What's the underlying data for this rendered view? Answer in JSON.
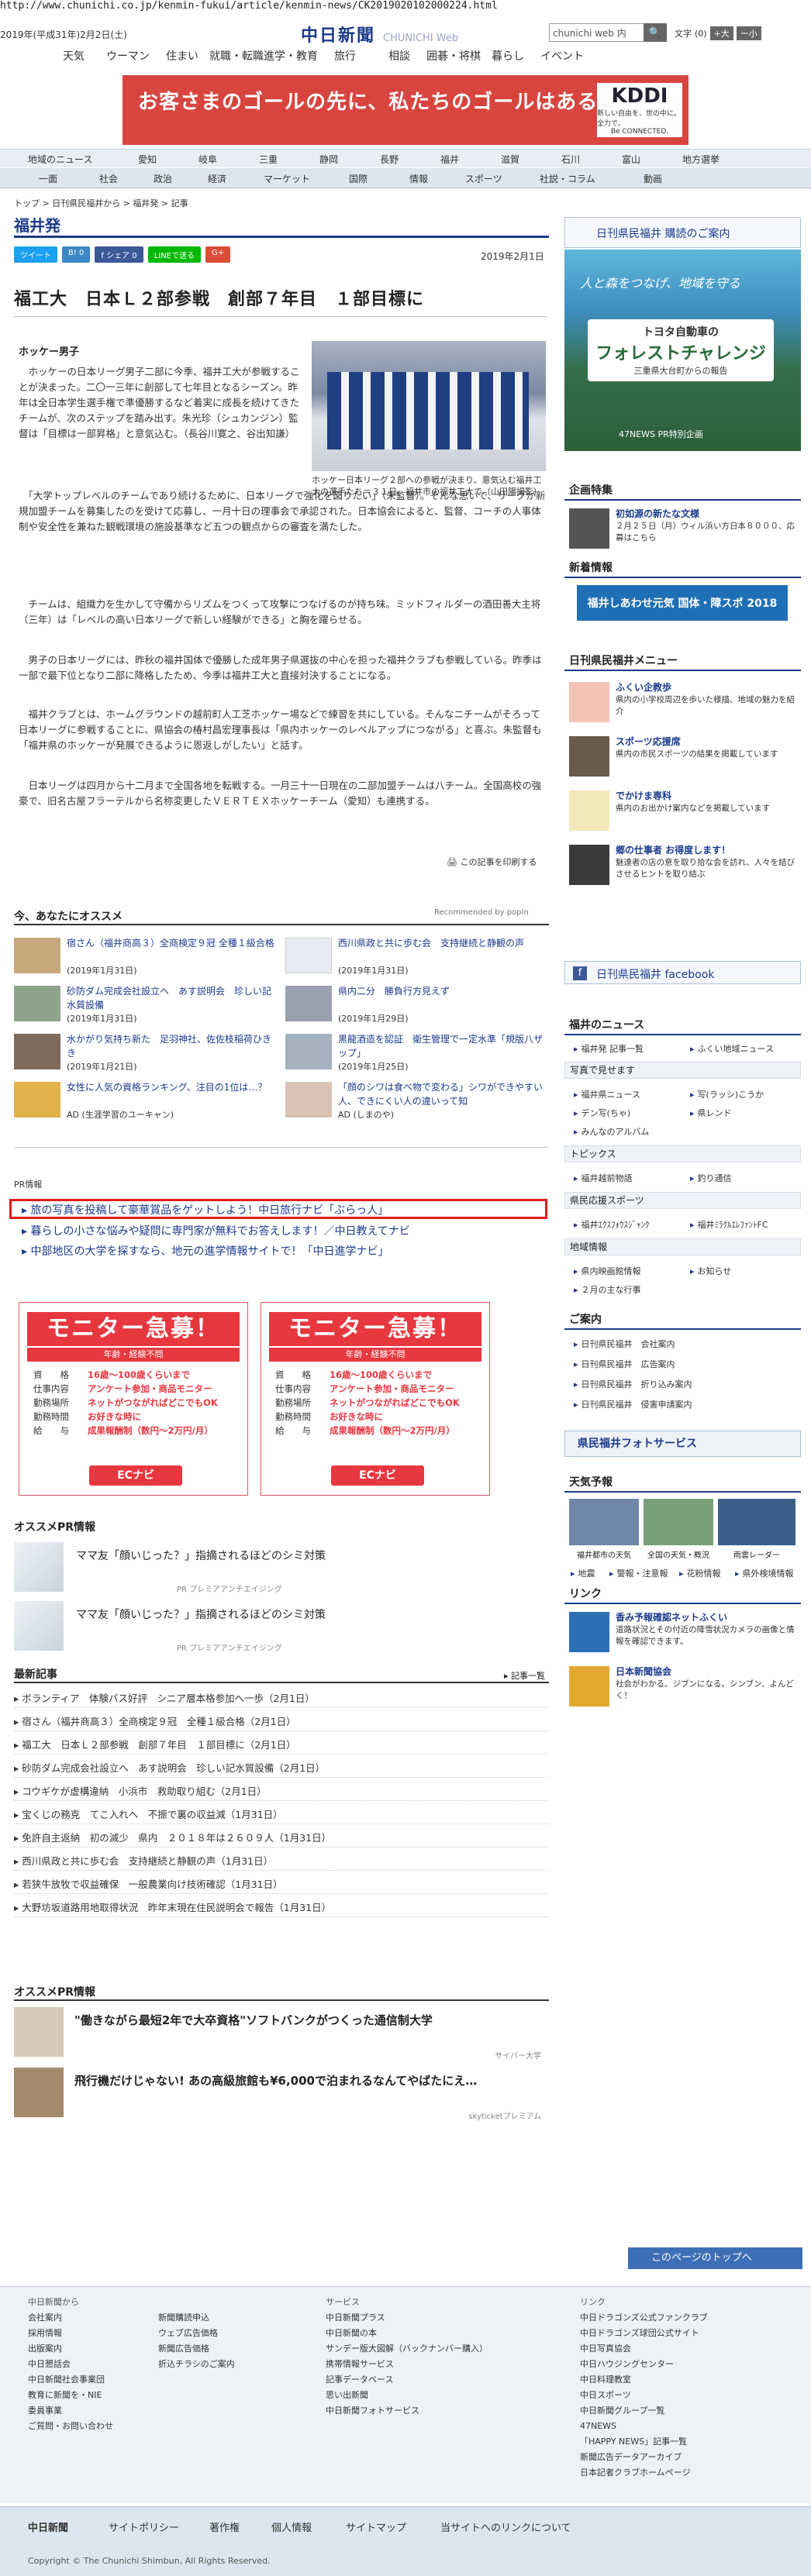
{
  "url": "http://www.chunichi.co.jp/kenmin-fukui/article/kenmin-news/CK2019020102000224.html",
  "header": {
    "date": "2019年(平成31年)2月2日(土)",
    "logo_jp": "中日新聞",
    "logo_en": "CHUNICHI Web",
    "search_placeholder": "chunichi web 内",
    "search_button": "🔍",
    "fontsize_label": "文字",
    "fontsize_value": "(0)",
    "fontsize_large": "+大",
    "fontsize_small": "ー小",
    "topnav": [
      "天気",
      "ウーマン",
      "住まい",
      "就職・転職",
      "進学・教育",
      "旅行",
      "相談",
      "囲碁・将棋",
      "暮らし",
      "イベント"
    ]
  },
  "ad1": {
    "text": "お客さまのゴールの先に、私たちのゴールはある。",
    "brand": "KDDI",
    "brand_sub": "新しい自由を、世の中に。全力で。",
    "brand_sub2": "Be CONNECTED."
  },
  "nav2": [
    "地域のニュース",
    "愛知",
    "岐阜",
    "三重",
    "静岡",
    "長野",
    "福井",
    "滋賀",
    "石川",
    "富山",
    "地方選挙"
  ],
  "nav3": [
    "一面",
    "社会",
    "政治",
    "経済",
    "マーケット",
    "国際",
    "情報",
    "スポーツ",
    "社説・コラム",
    "動画"
  ],
  "breadcrumb": "トップ > 日刊県民福井から > 福井発 > 記事",
  "section_title": "福井発",
  "share": {
    "tweet": "ツイート",
    "hatena": "B! 0",
    "facebook": "f シェア 0",
    "line": "LINEで送る",
    "gplus": "G+"
  },
  "pub_date": "2019年2月1日",
  "headline": "福工大　日本Ｌ２部参戦　創部７年目　１部目標に",
  "article": {
    "lead_title": "ホッケー男子",
    "p1": "　ホッケーの日本リーグ男子二部に今季、福井工大が参戦することが決まった。二〇一三年に創部して七年目となるシーズン。昨年は全日本学生選手権で準優勝するなど着実に成長を続けてきたチームが、次のステップを踏み出す。朱光珍（シュカンジン）監督は「目標は一部昇格」と意気込む。（長谷川寛之、谷出知謙）",
    "p2": "　「大学トップレベルのチームであり続けるために、日本リーグで強化を図りたい」（朱監督）。そんな思いで、リーグが新規加盟チームを募集したのを受けて応募し、一月十日の理事会で承認された。日本協会によると、監督、コーチの人事体制や安全性を兼ねた観戦環境の施設基準など五つの観点からの審査を満たした。",
    "p3": "　チームは、組織力を生かして守備からリズムをつくって攻撃につなげるのが持ち味。ミッドフィルダーの酒田善大主将（三年）は「レベルの高い日本リーグで新しい経験ができる」と胸を躍らせる。",
    "p4": "　男子の日本リーグには、昨秋の福井国体で優勝した成年男子県選抜の中心を担った福井クラブも参戦している。昨季は一部で最下位となり二部に降格したため、今季は福井工大と直接対決することになる。",
    "p5": "　福井クラブとは、ホームグラウンドの越前町人工芝ホッケー場などで練習を共にしている。そんなニチームがそろって日本リーグに参戦することに、県協会の椿村昌宏理事長は「県内ホッケーのレベルアップにつながる」と喜ぶ。朱監督も「福井県のホッケーが発展できるように恩返しがしたい」と話す。",
    "p6": "　日本リーグは四月から十二月まで全国各地を転戦する。一月三十一日現在の二部加盟チームは八チーム。全国高校の強豪で、旧名古屋フラーテルから名称変更したＶＥＲＴＥＸホッケーチーム（愛知）も連携する。",
    "photo_caption": "ホッケー日本リーグ２部への参戦が決まり、意気込む福井工大の選手たち＝３１日、福井市の福井工大で（山田陽撮影）",
    "print": "この記事を印刷する"
  },
  "reco": {
    "head": "今、あなたにオススメ",
    "by": "Recommended by popIn",
    "items": [
      {
        "text": "宿さん（福井商高３）全商検定９冠 全種１級合格",
        "date": "(2019年1月31日)"
      },
      {
        "text": "西川県政と共に歩む会　支持継続と静観の声",
        "date": "(2019年1月31日)"
      },
      {
        "text": "砂防ダム完成会社設立へ　あす説明会　珍しい記水質設備",
        "date": "(2019年1月31日)"
      },
      {
        "text": "県内二分　勝負行方見えず",
        "date": "(2019年1月29日)"
      },
      {
        "text": "水かがり気持ち新た　足羽神社、佐佐枝稲荷ひきき",
        "date": "(2019年1月21日)"
      },
      {
        "text": "黒龍酒造を認証　衛生管理で一定水準「規版八ザップ」",
        "date": "(2019年1月25日)"
      },
      {
        "text": "女性に人気の資格ランキング、注目の1位は…？",
        "date": "AD (生涯学習のユーキャン)"
      },
      {
        "text": "「顔のシワは食べ物で変わる」シワができやすい人、できにくい人の違いって知",
        "date": "AD (しまのや)"
      }
    ]
  },
  "pr": {
    "label": "PR情報",
    "links": [
      "旅の写真を投稿して豪華賞品をゲットしよう！中日旅行ナビ「ぶらっ人」",
      "暮らしの小さな悩みや疑問に専門家が無料でお答えします！／中日教えてナビ",
      "中部地区の大学を探すなら、地元の進学情報サイトで！「中日進学ナビ」"
    ]
  },
  "monitor": {
    "head": "モニター急募！",
    "sub": "年齢・経験不問",
    "rows": [
      {
        "k": "資　　格",
        "v": "16歳〜100歳くらいまで"
      },
      {
        "k": "仕事内容",
        "v": "アンケート参加・商品モニター"
      },
      {
        "k": "勤務場所",
        "v": "ネットがつながればどこでもOK"
      },
      {
        "k": "勤務時間",
        "v": "お好きな時に"
      },
      {
        "k": "給　　与",
        "v": "成果報酬制（数円〜2万円/月）"
      }
    ],
    "logo": "ECナビ"
  },
  "osusume": {
    "head": "オススメPR情報",
    "items": [
      {
        "text": "ママ友「顔いじった？」指摘されるほどのシミ対策",
        "pr": "PR プレミアアンチエイジング"
      },
      {
        "text": "ママ友「顔いじった？」指摘されるほどのシミ対策",
        "pr": "PR プレミアアンチエイジング"
      }
    ]
  },
  "latest": {
    "head": "最新記事",
    "list_btn": "記事一覧",
    "items": [
      "ボランティア　体験バス好評　シニア層本格参加へ一歩（2月1日）",
      "宿さん（福井商高３）全商検定９冠　全種１級合格（2月1日）",
      "福工大　日本Ｌ２部参戦　創部７年目　１部目標に（2月1日）",
      "砂防ダム完成会社設立へ　あす説明会　珍しい記水質設備（2月1日）",
      "コウギケが虚構違納　小浜市　救助取り組む（2月1日）",
      "宝くじの務克　てこ入れへ　不振で裏の収益減（1月31日）",
      "免許自主返納　初の減少　県内　２０１８年は２６０９人（1月31日）",
      "西川県政と共に歩む会　支持継続と静観の声（1月31日）",
      "若狭牛放牧で収益確保　一般農業向け技術確認（1月31日）",
      "大野坊坂道路用地取得状況　昨年末現在住民説明会で報告（1月31日）"
    ]
  },
  "osusume2": {
    "head": "オススメPR情報",
    "items": [
      {
        "text": "\"働きながら最短2年で大卒資格\"ソフトバンクがつくった通信制大学",
        "pr": "サイバー大学"
      },
      {
        "text": "飛行機だけじゃない! あの高級旅館も¥6,000で泊まれるなんてやばたにえ…",
        "pr": "skyticketプレミアム"
      }
    ]
  },
  "right": {
    "banner": "日刊県民福井 購読のご案内",
    "ad": {
      "t1": "人と森をつなげ、地域を守る",
      "t2a": "トヨタ自動車の",
      "t2b": "フォレストチャレンジ",
      "t2c": "三重県大台町からの報告",
      "t3": "47NEWS PR特別企画"
    },
    "project_head": "企画特集",
    "project_item": {
      "title": "初如源の新たな文様",
      "desc": "２月２５日（月）ウィル浜い方日本８０００、応募はこちら"
    },
    "new_head": "新着情報",
    "new_banner": "福井しあわせ元気 国体・障スポ 2018",
    "menu_head": "日刊県民福井メニュー",
    "menu": [
      {
        "title": "ふくい企教歩",
        "desc": "県内の小学校周辺を歩いた様描、地域の魅力を紹介"
      },
      {
        "title": "スポーツ応援席",
        "desc": "県内の市民スポーツの結果を掲載しています"
      },
      {
        "title": "でかけま専科",
        "desc": "県内のお出かけ案内などを掲載しています"
      },
      {
        "title": "郷の仕事者 お得度します！",
        "desc": "魅達者の店の意を取り拾な会を訪れ、人々を結びさせるヒントを取り結ぶ"
      }
    ],
    "facebook": "日刊県民福井 facebook",
    "news_head": "福井のニュース",
    "news_links": [
      "福井発 記事一覧",
      "ふくい地域ニュース"
    ],
    "photo_head": "写真で見せます",
    "photo_links": [
      "福井県ニュース",
      "写(ラッシ)こうか",
      "デン写(ちゃ)",
      "県レンド",
      "みんなのアルバム"
    ],
    "topics_head": "トピックス",
    "topics_links": [
      "福井越前物語",
      "釣り通信"
    ],
    "sports_head": "県民応援スポーツ",
    "sports_links": [
      "福井ｴｸｽﾌｫｳｽｼﾞｬﾝｸ",
      "福井ﾐﾗｸﾙｴﾚﾌｧﾝﾄFC"
    ],
    "region_head": "地域情報",
    "region_links": [
      "県内映画館情報",
      "お知らせ",
      "２月の主な行事"
    ],
    "guide_head": "ご案内",
    "guide_links": [
      "日刊県民福井　会社案内",
      "日刊県民福井　広告案内",
      "日刊県民福井　折り込み案内",
      "日刊県民福井　侵害申請案内"
    ],
    "photo_service": "県民福井フォトサービス",
    "weather_head": "天気予報",
    "weather_items": [
      "福井都市の天気",
      "全国の天気・概況",
      "雨雲レーダー"
    ],
    "weather_links": [
      "地震",
      "警報・注意報",
      "花粉情報",
      "県外検境情報"
    ],
    "link_head": "リンク",
    "link_items": [
      {
        "title": "香み予報確認ネットふくい",
        "desc": "道路状況とその付近の降雪状況カメラの画像と情報を確認できます。"
      },
      {
        "title": "日本新聞協会",
        "desc": "社会がわかる。ジブンになる。シンブン、よんどく！"
      }
    ]
  },
  "footer": {
    "to_top": "このページのトップへ",
    "col1": [
      "中日新聞から",
      "会社案内",
      "採用情報",
      "出版案内",
      "中日懇話会",
      "中日新聞社会事業団",
      "教育に新聞を・NIE",
      "委員事業",
      "ご質問・お問い合わせ"
    ],
    "col2": [
      "新聞購読申込",
      "ウェブ広告価格",
      "新聞広告価格",
      "折込チラシのご案内"
    ],
    "col3": [
      "サービス",
      "中日新聞プラス",
      "中日新聞の本",
      "サンデー版大図解（バックナンバー購入）",
      "携帯情報サービス",
      "記事データベース",
      "思い出新聞",
      "中日新聞フォトサービス"
    ],
    "col4": [
      "リンク",
      "中日ドラゴンズ公式ファンクラブ",
      "中日ドラゴンズ球団公式サイト",
      "中日写真協会",
      "中日ハウジングセンター",
      "中日料理教室",
      "中日スポーツ",
      "中日新聞グループ一覧",
      "47NEWS",
      "「HAPPY NEWS」記事一覧",
      "新聞広告データアーカイブ",
      "日本記者クラブホームページ"
    ],
    "nav": [
      "中日新聞",
      "サイトポリシー",
      "著作権",
      "個人情報",
      "サイトマップ",
      "当サイトへのリンクについて"
    ],
    "copyright": "Copyright © The Chunichi Shimbun, All Rights Reserved."
  }
}
